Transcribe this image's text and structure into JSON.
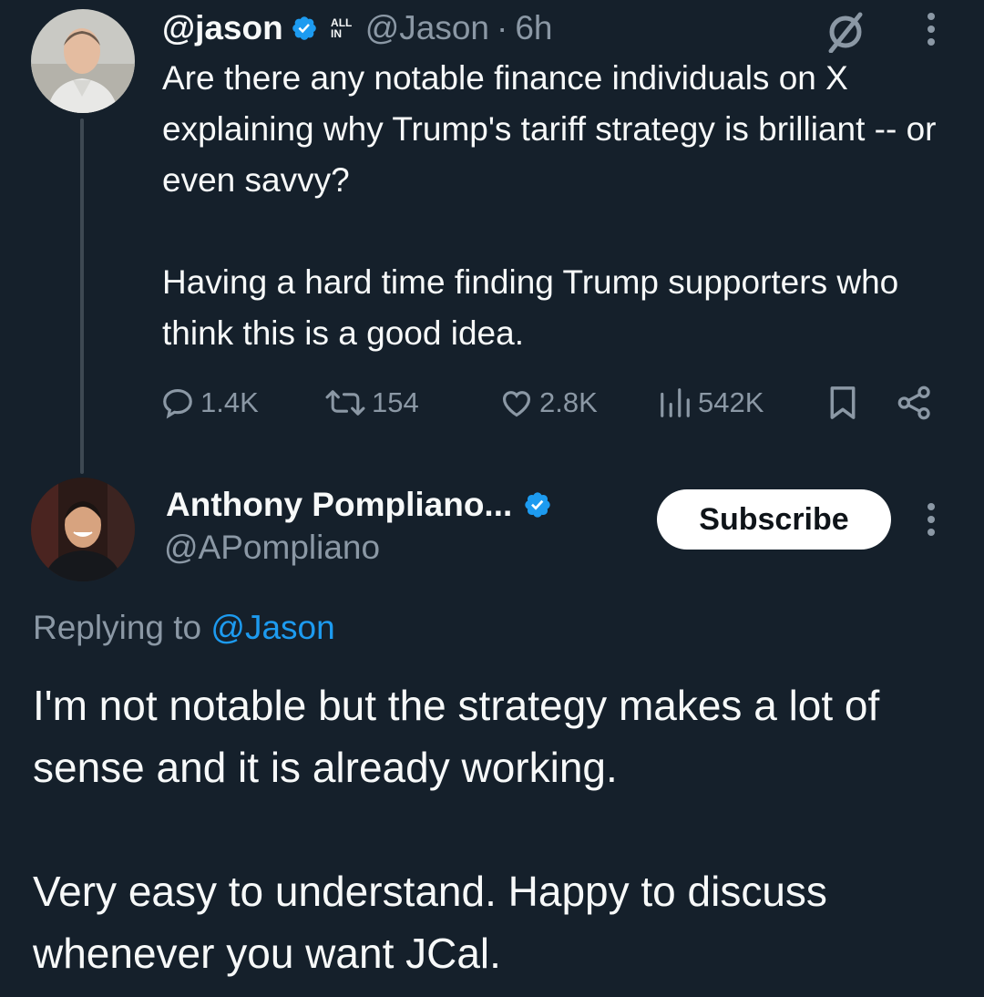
{
  "parent_tweet": {
    "display_name": "@jason",
    "affiliation_badge": "ALL IN",
    "handle": "@Jason",
    "separator": "·",
    "time": "6h",
    "text": "Are there any notable finance individuals on X explaining why Trump's tariff strategy is brilliant -- or even savvy?\n\nHaving a hard time finding Trump supporters who think this is a good idea.",
    "stats": {
      "replies": "1.4K",
      "reposts": "154",
      "likes": "2.8K",
      "views": "542K"
    },
    "icons": [
      "grok-icon",
      "more-icon",
      "reply-icon",
      "repost-icon",
      "like-icon",
      "views-icon",
      "bookmark-icon",
      "share-icon"
    ]
  },
  "reply_tweet": {
    "display_name": "Anthony Pompliano...",
    "handle": "@APompliano",
    "subscribe_label": "Subscribe",
    "replying_prefix": "Replying to",
    "replying_to": "@Jason",
    "text": "I'm not notable but the strategy makes a lot of sense and it is already working.\n\nVery easy to understand. Happy to discuss whenever you want JCal."
  },
  "colors": {
    "background": "#15202b",
    "text_primary": "#f7f9f9",
    "text_secondary": "#8b98a5",
    "accent": "#1d9bf0"
  }
}
